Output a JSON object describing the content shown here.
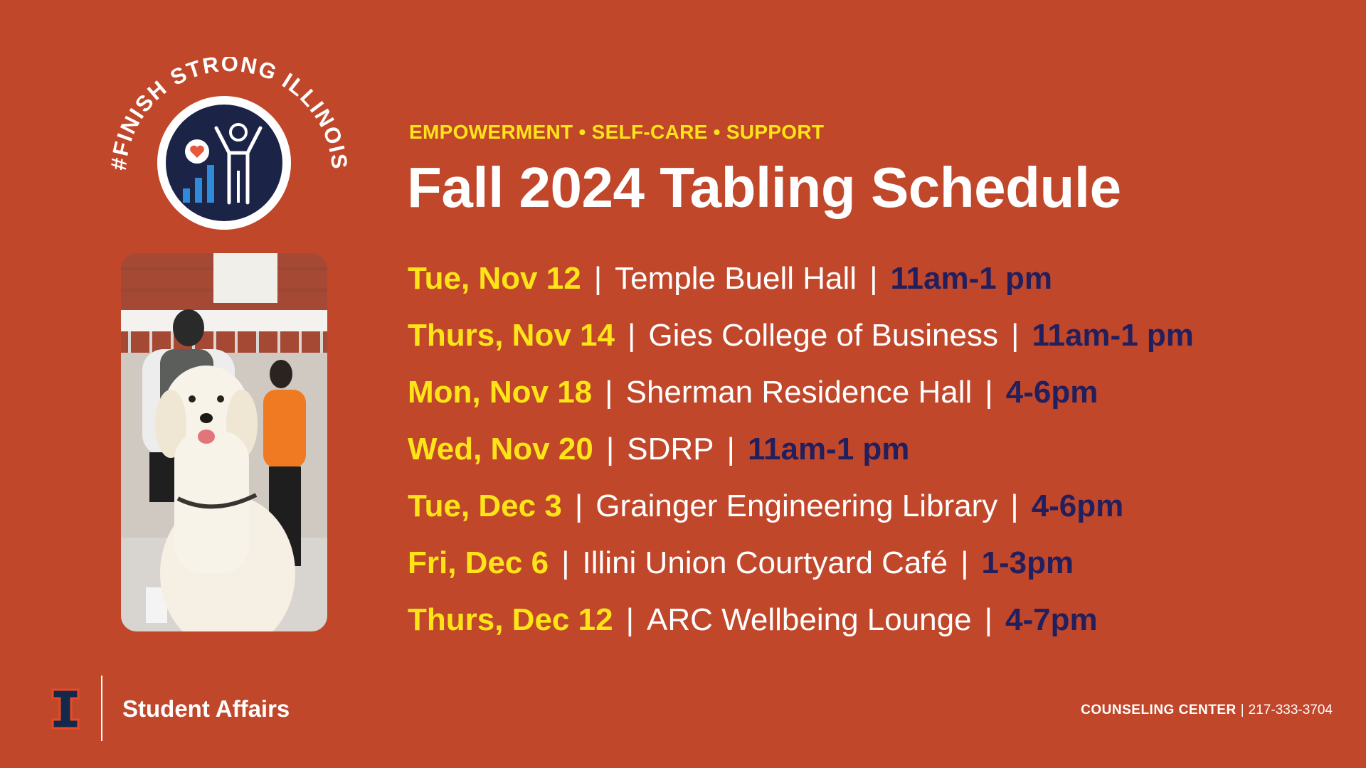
{
  "badge": {
    "arc_text": "#FINISH STRONG ILLINOIS",
    "icon": "wellbeing-person-chart-heart-icon"
  },
  "photo": {
    "subject": "golden-retriever-photo"
  },
  "header": {
    "tagline": "EMPOWERMENT • SELF-CARE • SUPPORT",
    "title": "Fall 2024 Tabling Schedule"
  },
  "schedule": [
    {
      "date": "Tue, Nov 12",
      "location": "Temple Buell Hall",
      "time": "11am-1 pm"
    },
    {
      "date": "Thurs, Nov 14",
      "location": "Gies College of Business",
      "time": "11am-1 pm"
    },
    {
      "date": "Mon, Nov 18",
      "location": "Sherman Residence Hall",
      "time": "4-6pm"
    },
    {
      "date": "Wed, Nov 20",
      "location": "SDRP",
      "time": "11am-1 pm"
    },
    {
      "date": "Tue, Dec 3",
      "location": "Grainger Engineering Library",
      "time": "4-6pm"
    },
    {
      "date": "Fri, Dec 6",
      "location": "Illini Union Courtyard Café",
      "time": "1-3pm"
    },
    {
      "date": "Thurs, Dec 12",
      "location": "ARC Wellbeing Lounge",
      "time": "4-7pm"
    }
  ],
  "separator": "|",
  "footer": {
    "logo": "block-i-logo",
    "unit": "Student Affairs",
    "office": "COUNSELING CENTER",
    "divider": "|",
    "phone": "217-333-3704"
  },
  "colors": {
    "background": "#c1472b",
    "date_yellow": "#ffe418",
    "time_navy": "#231f5c",
    "text_white": "#ffffff",
    "badge_navy": "#1b2347",
    "icon_blue": "#2f8ad8"
  }
}
